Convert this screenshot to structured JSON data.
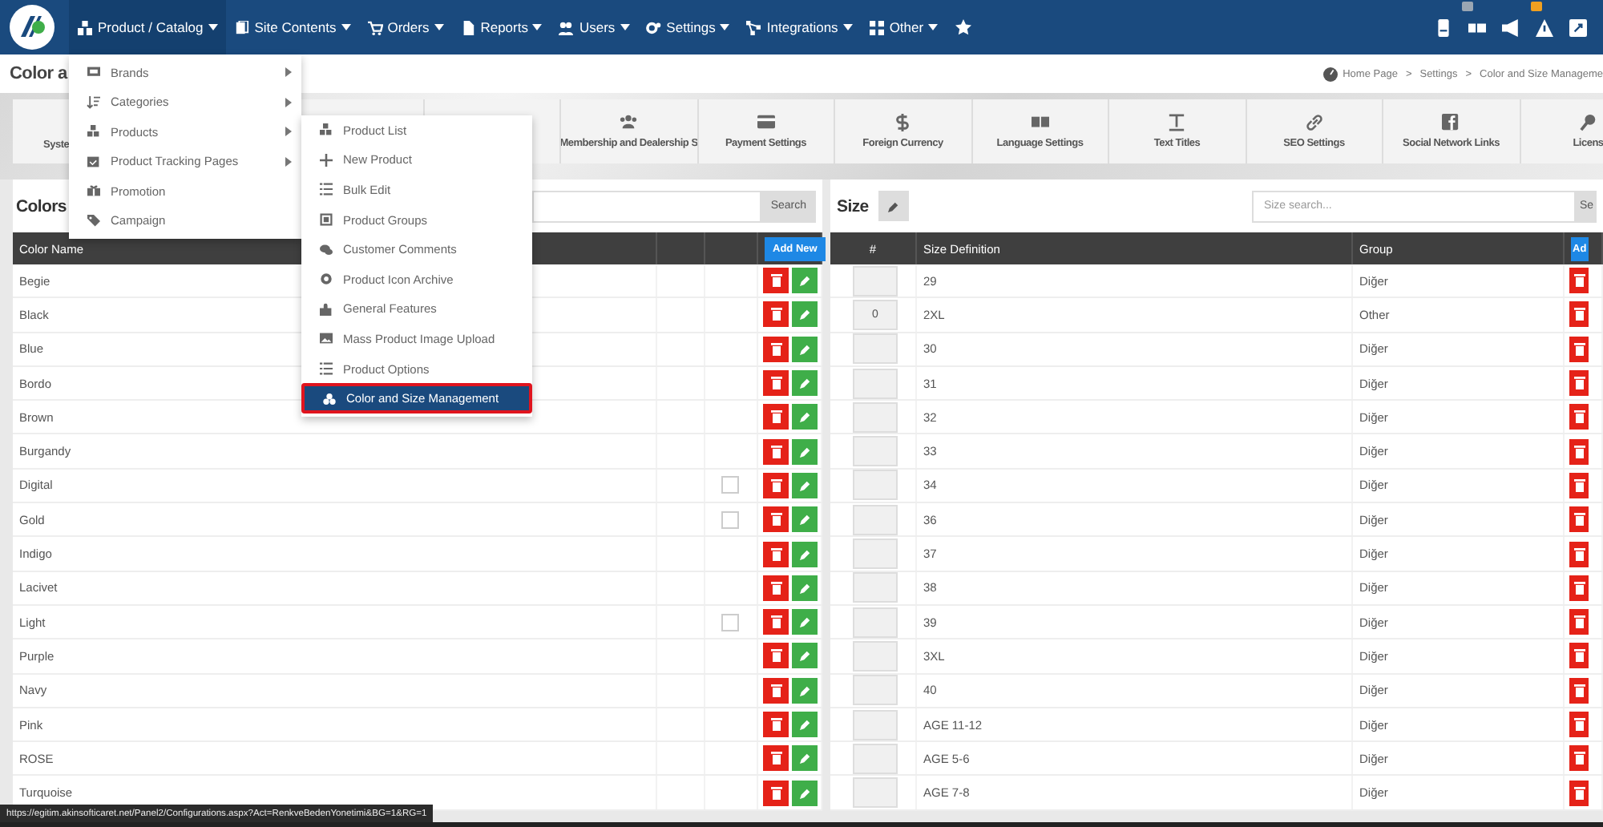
{
  "nav": {
    "items": [
      {
        "label": "Product / Catalog",
        "selected": true
      },
      {
        "label": "Site Contents",
        "selected": false
      },
      {
        "label": "Orders",
        "selected": false
      },
      {
        "label": "Reports",
        "selected": false
      },
      {
        "label": "Users",
        "selected": false
      },
      {
        "label": "Settings",
        "selected": false
      },
      {
        "label": "Integrations",
        "selected": false
      },
      {
        "label": "Other",
        "selected": false
      }
    ]
  },
  "page_title": "Color a",
  "breadcrumb": {
    "separator": ">",
    "items": [
      "Home Page",
      "Settings",
      "Color and Size Manageme"
    ]
  },
  "shortcuts": [
    {
      "kind": "cut",
      "label": "Syste"
    },
    {
      "kind": "covered"
    },
    {
      "kind": "covered"
    },
    {
      "kind": "covered"
    },
    {
      "kind": "tile",
      "label": "Membership and Dealership S"
    },
    {
      "kind": "tile",
      "label": "Payment Settings"
    },
    {
      "kind": "tile",
      "label": "Foreign Currency"
    },
    {
      "kind": "tile",
      "label": "Language Settings"
    },
    {
      "kind": "tile",
      "label": "Text Titles"
    },
    {
      "kind": "tile",
      "label": "SEO Settings"
    },
    {
      "kind": "tile",
      "label": "Social Network Links"
    },
    {
      "kind": "tile",
      "label": "Licens"
    }
  ],
  "colors_panel": {
    "title": "Colors",
    "search_button": "Search",
    "columns": [
      "Color Name"
    ],
    "add_button": "Add New",
    "rows": [
      {
        "name": "Begie"
      },
      {
        "name": "Black"
      },
      {
        "name": "Blue"
      },
      {
        "name": "Bordo"
      },
      {
        "name": "Brown"
      },
      {
        "name": "Burgandy"
      },
      {
        "name": "Digital",
        "checked": false
      },
      {
        "name": "Gold",
        "checked": false
      },
      {
        "name": "Indigo"
      },
      {
        "name": "Lacivet"
      },
      {
        "name": "Light",
        "checked": false
      },
      {
        "name": "Purple"
      },
      {
        "name": "Navy"
      },
      {
        "name": "Pink"
      },
      {
        "name": "ROSE"
      },
      {
        "name": "Turquoise"
      }
    ]
  },
  "size_panel": {
    "title": "Size",
    "search": {
      "placeholder": "Size search..."
    },
    "search_button": "Se",
    "columns": [
      "#",
      "Size Definition",
      "Group"
    ],
    "add_button": "Ad",
    "rows": [
      {
        "size": "29",
        "group": "Diğer"
      },
      {
        "order": "0",
        "size": "2XL",
        "group": "Other"
      },
      {
        "size": "30",
        "group": "Diğer"
      },
      {
        "size": "31",
        "group": "Diğer"
      },
      {
        "size": "32",
        "group": "Diğer"
      },
      {
        "size": "33",
        "group": "Diğer"
      },
      {
        "size": "34",
        "group": "Diğer"
      },
      {
        "size": "36",
        "group": "Diğer"
      },
      {
        "size": "37",
        "group": "Diğer"
      },
      {
        "size": "38",
        "group": "Diğer"
      },
      {
        "size": "39",
        "group": "Diğer"
      },
      {
        "size": "3XL",
        "group": "Diğer"
      },
      {
        "size": "40",
        "group": "Diğer"
      },
      {
        "size": "AGE 11-12",
        "group": "Diğer"
      },
      {
        "size": "AGE 5-6",
        "group": "Diğer"
      },
      {
        "size": "AGE 7-8",
        "group": "Diğer"
      }
    ]
  },
  "menu": {
    "items": [
      {
        "label": "Brands",
        "submenu": true
      },
      {
        "label": "Categories",
        "submenu": true
      },
      {
        "label": "Products",
        "submenu": true
      },
      {
        "label": "Product Tracking Pages",
        "submenu": true
      },
      {
        "label": "Promotion",
        "submenu": false
      },
      {
        "label": "Campaign",
        "submenu": false
      }
    ]
  },
  "submenu": {
    "items": [
      {
        "label": "Product List",
        "selected": false
      },
      {
        "label": "New Product",
        "selected": false
      },
      {
        "label": "Bulk Edit",
        "selected": false
      },
      {
        "label": "Product Groups",
        "selected": false
      },
      {
        "label": "Customer Comments",
        "selected": false
      },
      {
        "label": "Product Icon Archive",
        "selected": false
      },
      {
        "label": "General Features",
        "selected": false
      },
      {
        "label": "Mass Product Image Upload",
        "selected": false
      },
      {
        "label": "Product Options",
        "selected": false
      },
      {
        "label": "Color and Size Management",
        "selected": true
      }
    ]
  },
  "status_url": "https://egitim.akinsofticaret.net/Panel2/Configurations.aspx?Act=RenkveBedenYonetimi&BG=1&RG=1"
}
